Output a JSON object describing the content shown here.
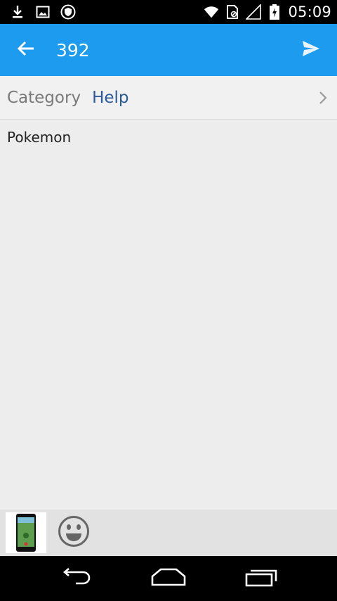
{
  "status_bar": {
    "time": "05:09",
    "icons_left": [
      "download-icon",
      "image-icon",
      "shield-icon"
    ],
    "icons_right": [
      "wifi-icon",
      "sim-icon",
      "signal-icon",
      "battery-icon"
    ]
  },
  "app_bar": {
    "title": "392",
    "background_color": "#1d9bef"
  },
  "category": {
    "label": "Category",
    "value": "Help"
  },
  "content": {
    "text": "Pokemon"
  },
  "attachments": {
    "thumbnail": "phone-screenshot-thumbnail",
    "emoji_button": "emoji-icon"
  },
  "nav_bar": {
    "buttons": [
      "back-icon",
      "home-icon",
      "recents-icon"
    ]
  }
}
